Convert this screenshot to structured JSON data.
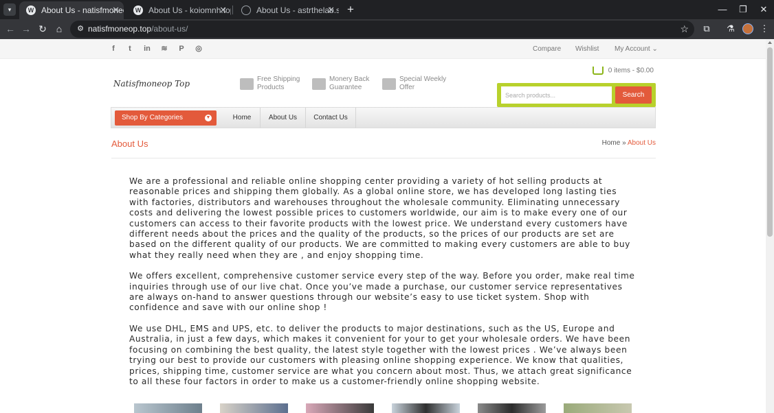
{
  "browser": {
    "tabs": [
      {
        "title": "About Us - natisfmoneop.top",
        "active": true
      },
      {
        "title": "About Us - koiomnh.top",
        "active": false
      },
      {
        "title": "About Us - astrthelab.shop",
        "active": false
      }
    ],
    "url_host": "natisfmoneop.top",
    "url_path": "/about-us/"
  },
  "topbar": {
    "social": [
      "facebook-icon",
      "twitter-icon",
      "linkedin-icon",
      "rss-icon",
      "pinterest-icon",
      "instagram-icon"
    ],
    "links": {
      "compare": "Compare",
      "wishlist": "Wishlist",
      "account": "My Account"
    }
  },
  "header": {
    "logo": "Natisfmoneop Top",
    "features": [
      {
        "line1": "Free Shipping",
        "line2": "Products"
      },
      {
        "line1": "Monery Back",
        "line2": "Guarantee"
      },
      {
        "line1": "Special Weekly",
        "line2": "Offer"
      }
    ],
    "cart": {
      "items": "0 items -",
      "total": "$0.00"
    },
    "search": {
      "placeholder": "Search products...",
      "button": "Search"
    }
  },
  "nav": {
    "categories": "Shop By Categories",
    "links": [
      "Home",
      "About Us",
      "Contact Us"
    ]
  },
  "page": {
    "title": "About Us",
    "breadcrumb": {
      "home": "Home",
      "sep": "»",
      "current": "About Us"
    },
    "paragraphs": [
      "We are a professional and reliable online shopping center providing a variety of hot selling products at reasonable prices and shipping them globally. As a global online store, we has developed long lasting ties with factories, distributors and warehouses throughout the wholesale community. Eliminating unnecessary costs and delivering the lowest possible prices to customers worldwide, our aim is to make every one of our customers can access to their favorite products with the lowest price. We understand every customers have different needs about the prices and the quality of the products, so the prices of our products are set are based on the different quality of our products. We are committed to making every customers are able to buy what they really need when they are , and enjoy shopping time.",
      "We offers excellent, comprehensive customer service every step of the way. Before you order, make real time inquiries through use of our live chat. Once you’ve made a purchase, our customer service representatives are always on-hand to answer questions through our website’s easy to use ticket system. Shop with confidence and save with  our online shop !",
      "We use DHL, EMS and UPS, etc. to deliver the products to major destinations, such as the US, Europe and Australia, in just a few days, which makes it convenient for your to get your wholesale orders. We have been focusing on combining the best quality, the latest style together with the lowest prices . We’ve always been trying our best to provide our customers with pleasing online shopping experience. We know that qualities, prices, shipping time, customer service are what you concern about most. Thus, we attach great significance to all these four factors in order to make us a customer-friendly online shopping website."
    ]
  },
  "colors": {
    "accent": "#e35a3b",
    "search_border": "#b8d12c",
    "cart_icon": "#8cb51a"
  }
}
